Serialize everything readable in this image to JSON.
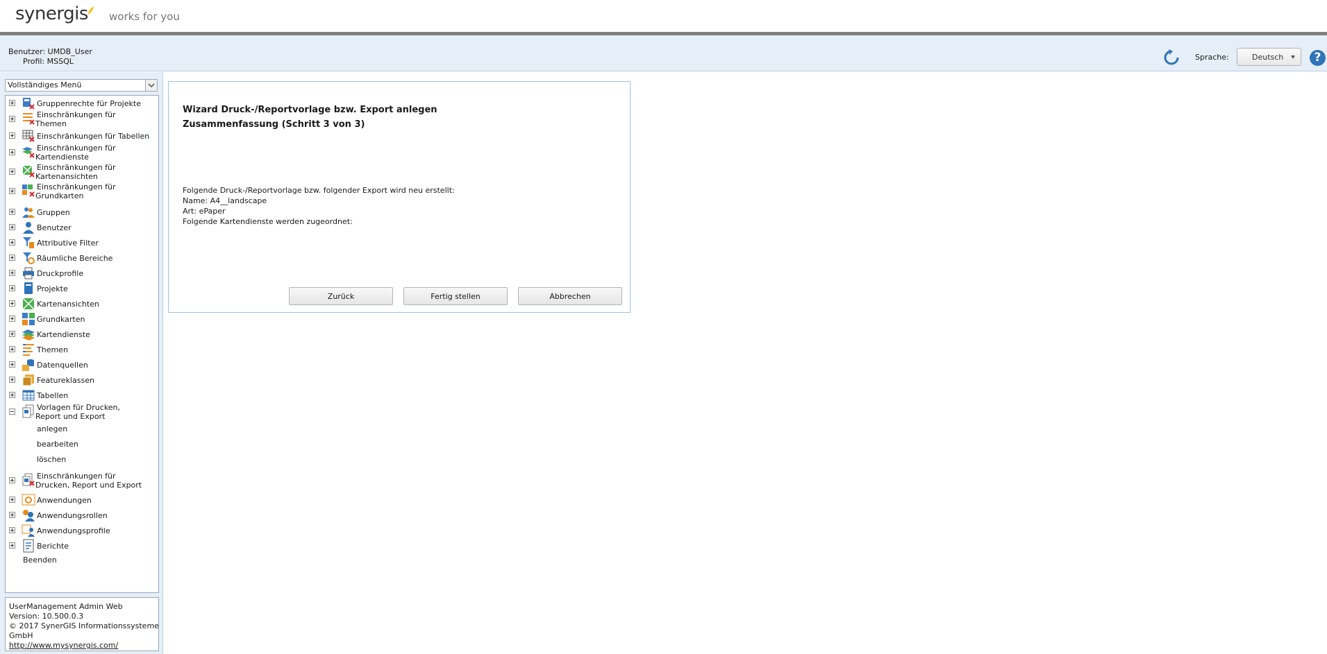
{
  "header": {
    "logo": "synergis",
    "tagline": "works for you"
  },
  "userbar": {
    "user_label": "Benutzer:",
    "user_value": "UMDB_User",
    "profile_label": "Profil:",
    "profile_value": "MSSQL",
    "language_label": "Sprache:",
    "language_value": "Deutsch",
    "help_glyph": "?"
  },
  "sidebar": {
    "menu_select": "Vollständiges Menü",
    "tree": [
      {
        "label": "Gruppenrechte für Projekte",
        "icon": "group-rights-icon"
      },
      {
        "label_a": "Einschränkungen für",
        "label_b": "Themen",
        "icon": "theme-restriction-icon"
      },
      {
        "label": "Einschränkungen für Tabellen",
        "icon": "table-restriction-icon"
      },
      {
        "label_a": "Einschränkungen für",
        "label_b": "Kartendienste",
        "icon": "mapservice-restriction-icon"
      },
      {
        "label_a": "Einschränkungen für",
        "label_b": "Kartenansichten",
        "icon": "mapview-restriction-icon"
      },
      {
        "label_a": "Einschränkungen für",
        "label_b": "Grundkarten",
        "icon": "basemap-restriction-icon"
      },
      {
        "label": "Gruppen",
        "icon": "groups-icon"
      },
      {
        "label": "Benutzer",
        "icon": "user-icon"
      },
      {
        "label": "Attributive Filter",
        "icon": "filter-icon"
      },
      {
        "label": "Räumliche Bereiche",
        "icon": "spatial-filter-icon"
      },
      {
        "label": "Druckprofile",
        "icon": "printer-icon"
      },
      {
        "label": "Projekte",
        "icon": "project-icon"
      },
      {
        "label": "Kartenansichten",
        "icon": "mapview-icon"
      },
      {
        "label": "Grundkarten",
        "icon": "basemap-icon"
      },
      {
        "label": "Kartendienste",
        "icon": "mapservice-icon"
      },
      {
        "label": "Themen",
        "icon": "theme-icon"
      },
      {
        "label": "Datenquellen",
        "icon": "datasource-icon"
      },
      {
        "label": "Featureklassen",
        "icon": "featureclass-icon"
      },
      {
        "label": "Tabellen",
        "icon": "table-icon"
      },
      {
        "label_a": "Vorlagen für Drucken,",
        "label_b": "Report und Export",
        "icon": "templates-icon"
      }
    ],
    "sub_items": [
      "anlegen",
      "bearbeiten",
      "löschen"
    ],
    "tree_after": [
      {
        "label_a": "Einschränkungen für",
        "label_b": "Drucken, Report und Export",
        "icon": "print-restriction-icon"
      },
      {
        "label": "Anwendungen",
        "icon": "application-icon"
      },
      {
        "label": "Anwendungsrollen",
        "icon": "app-roles-icon"
      },
      {
        "label": "Anwendungsprofile",
        "icon": "app-profiles-icon"
      },
      {
        "label": "Berichte",
        "icon": "reports-icon"
      }
    ],
    "exit": "Beenden",
    "info": {
      "product": "UserManagement Admin Web",
      "version": "Version: 10.500.0.3",
      "copyright": "© 2017 SynerGIS Informationssysteme",
      "company": "GmbH",
      "link": "http://www.mysynergis.com/"
    }
  },
  "wizard": {
    "title": "Wizard Druck-/Reportvorlage bzw. Export anlegen",
    "step": "Zusammenfassung (Schritt 3 von 3)",
    "summary": [
      "Folgende Druck-/Reportvorlage bzw. folgender Export wird neu erstellt:",
      "Name: A4__landscape",
      "Art: ePaper",
      "Folgende Kartendienste werden zugeordnet:"
    ],
    "buttons": {
      "back": "Zurück",
      "finish": "Fertig stellen",
      "cancel": "Abbrechen"
    }
  },
  "colors": {
    "accent_blue": "#2f73b8",
    "panel_bg": "#e6eef7",
    "logo_yellow": "#f2c318"
  }
}
